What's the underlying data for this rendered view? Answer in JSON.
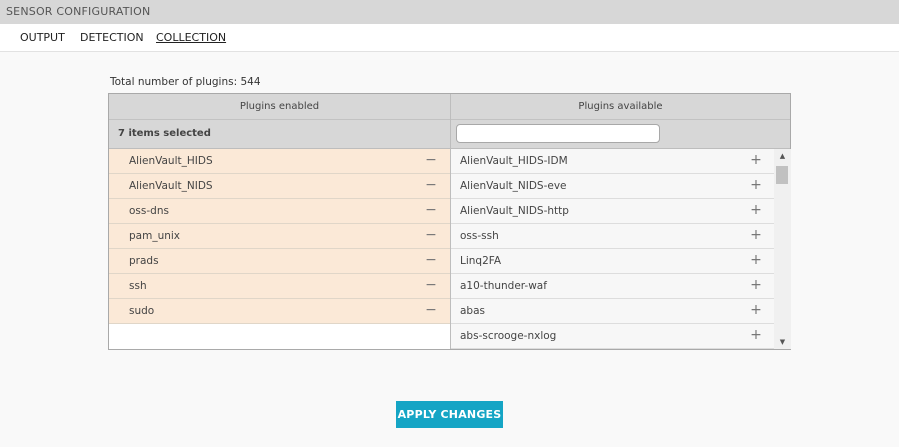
{
  "title": "SENSOR CONFIGURATION",
  "tabs": [
    {
      "label": "OUTPUT",
      "active": false
    },
    {
      "label": "DETECTION",
      "active": false
    },
    {
      "label": "COLLECTION",
      "active": true
    }
  ],
  "total_label": "Total number of plugins: 544",
  "enabled": {
    "header": "Plugins enabled",
    "selected_label": "7 items selected",
    "items": [
      "AlienVault_HIDS",
      "AlienVault_NIDS",
      "oss-dns",
      "pam_unix",
      "prads",
      "ssh",
      "sudo"
    ],
    "remove_glyph": "−"
  },
  "available": {
    "header": "Plugins available",
    "filter_value": "",
    "items": [
      "AlienVault_HIDS-IDM",
      "AlienVault_NIDS-eve",
      "AlienVault_NIDS-http",
      "oss-ssh",
      "Linq2FA",
      "a10-thunder-waf",
      "abas",
      "abs-scrooge-nxlog"
    ],
    "add_glyph": "+"
  },
  "scroll_up_glyph": "▲",
  "scroll_down_glyph": "▼",
  "apply_label": "APPLY CHANGES",
  "colors": {
    "accent": "#15a5c5",
    "enabled_row": "#fbe9d7",
    "header_bg": "#d7d7d7"
  }
}
